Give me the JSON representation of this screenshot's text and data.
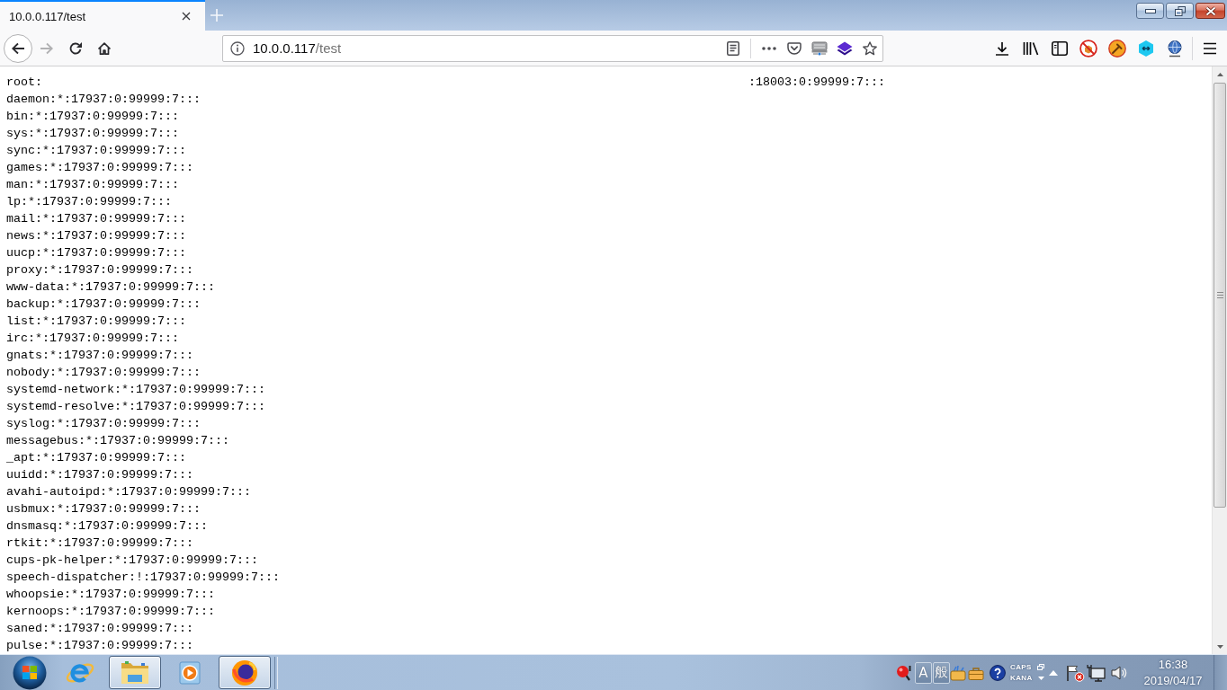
{
  "tabs": [
    {
      "title": "10.0.0.117/test",
      "selected": true
    }
  ],
  "nav_buttons": [
    {
      "kind": "back",
      "disabled": false
    },
    {
      "kind": "forward",
      "disabled": true
    },
    {
      "kind": "reload",
      "disabled": false
    },
    {
      "kind": "home",
      "disabled": false
    }
  ],
  "address_bar": {
    "host": "10.0.0.117",
    "path": "/test"
  },
  "page": {
    "lines": [
      {
        "text": "root:",
        "tail": ":18003:0:99999:7:::"
      },
      {
        "text": "daemon:*:17937:0:99999:7:::"
      },
      {
        "text": "bin:*:17937:0:99999:7:::"
      },
      {
        "text": "sys:*:17937:0:99999:7:::"
      },
      {
        "text": "sync:*:17937:0:99999:7:::"
      },
      {
        "text": "games:*:17937:0:99999:7:::"
      },
      {
        "text": "man:*:17937:0:99999:7:::"
      },
      {
        "text": "lp:*:17937:0:99999:7:::"
      },
      {
        "text": "mail:*:17937:0:99999:7:::"
      },
      {
        "text": "news:*:17937:0:99999:7:::"
      },
      {
        "text": "uucp:*:17937:0:99999:7:::"
      },
      {
        "text": "proxy:*:17937:0:99999:7:::"
      },
      {
        "text": "www-data:*:17937:0:99999:7:::"
      },
      {
        "text": "backup:*:17937:0:99999:7:::"
      },
      {
        "text": "list:*:17937:0:99999:7:::"
      },
      {
        "text": "irc:*:17937:0:99999:7:::"
      },
      {
        "text": "gnats:*:17937:0:99999:7:::"
      },
      {
        "text": "nobody:*:17937:0:99999:7:::"
      },
      {
        "text": "systemd-network:*:17937:0:99999:7:::"
      },
      {
        "text": "systemd-resolve:*:17937:0:99999:7:::"
      },
      {
        "text": "syslog:*:17937:0:99999:7:::"
      },
      {
        "text": "messagebus:*:17937:0:99999:7:::"
      },
      {
        "text": "_apt:*:17937:0:99999:7:::"
      },
      {
        "text": "uuidd:*:17937:0:99999:7:::"
      },
      {
        "text": "avahi-autoipd:*:17937:0:99999:7:::"
      },
      {
        "text": "usbmux:*:17937:0:99999:7:::"
      },
      {
        "text": "dnsmasq:*:17937:0:99999:7:::"
      },
      {
        "text": "rtkit:*:17937:0:99999:7:::"
      },
      {
        "text": "cups-pk-helper:*:17937:0:99999:7:::"
      },
      {
        "text": "speech-dispatcher:!:17937:0:99999:7:::"
      },
      {
        "text": "whoopsie:*:17937:0:99999:7:::"
      },
      {
        "text": "kernoops:*:17937:0:99999:7:::"
      },
      {
        "text": "saned:*:17937:0:99999:7:::"
      },
      {
        "text": "pulse:*:17937:0:99999:7:::"
      }
    ]
  },
  "taskbar": {
    "apps": [
      {
        "kind": "ie",
        "running": false
      },
      {
        "kind": "explorer",
        "running": true
      },
      {
        "kind": "media",
        "running": false
      },
      {
        "kind": "firefox",
        "running": true
      }
    ],
    "tray": {
      "ime": [
        "A",
        "般"
      ],
      "caps": "CAPS",
      "kana": "KANA"
    },
    "clock": {
      "time": "16:38",
      "date": "2019/04/17"
    }
  }
}
